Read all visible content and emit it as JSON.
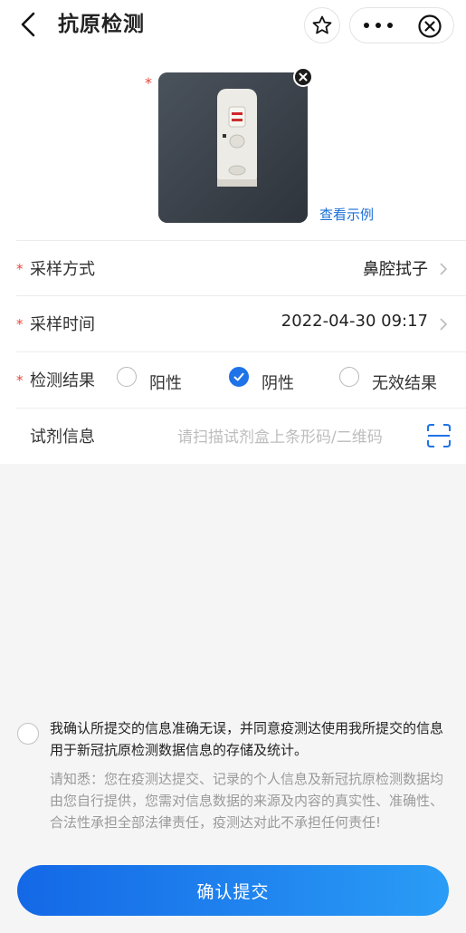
{
  "header": {
    "title": "抗原检测",
    "icons": {
      "back": "back-arrow-icon",
      "favorite": "star-icon",
      "more": "more-dots-icon",
      "close": "close-circle-icon"
    }
  },
  "photo": {
    "required_mark": "*",
    "example_link": "查看示例",
    "icons": {
      "delete": "close-icon"
    }
  },
  "form": {
    "sampling_method": {
      "required_mark": "*",
      "label": "采样方式",
      "value": "鼻腔拭子"
    },
    "sampling_time": {
      "required_mark": "*",
      "label": "采样时间",
      "value": "2022-04-30 09:17"
    },
    "result": {
      "required_mark": "*",
      "label": "检测结果",
      "options": [
        {
          "label": "阳性",
          "selected": false
        },
        {
          "label": "阴性",
          "selected": true
        },
        {
          "label": "无效结果",
          "selected": false
        }
      ]
    },
    "reagent": {
      "label": "试剂信息",
      "placeholder": "请扫描试剂盒上条形码/二维码",
      "icon": "scan-icon"
    }
  },
  "agreement": {
    "checked": false,
    "text": "我确认所提交的信息准确无误，并同意疫测达使用我所提交的信息用于新冠抗原检测数据信息的存储及统计。",
    "notice": "请知悉：您在疫测达提交、记录的个人信息及新冠抗原检测数据均由您自行提供，您需对信息数据的来源及内容的真实性、准确性、合法性承担全部法律责任，疫测达对此不承担任何责任!"
  },
  "submit_label": "确认提交",
  "colors": {
    "accent": "#1f73e8",
    "required": "#e8473b",
    "link": "#1a6fd8"
  }
}
